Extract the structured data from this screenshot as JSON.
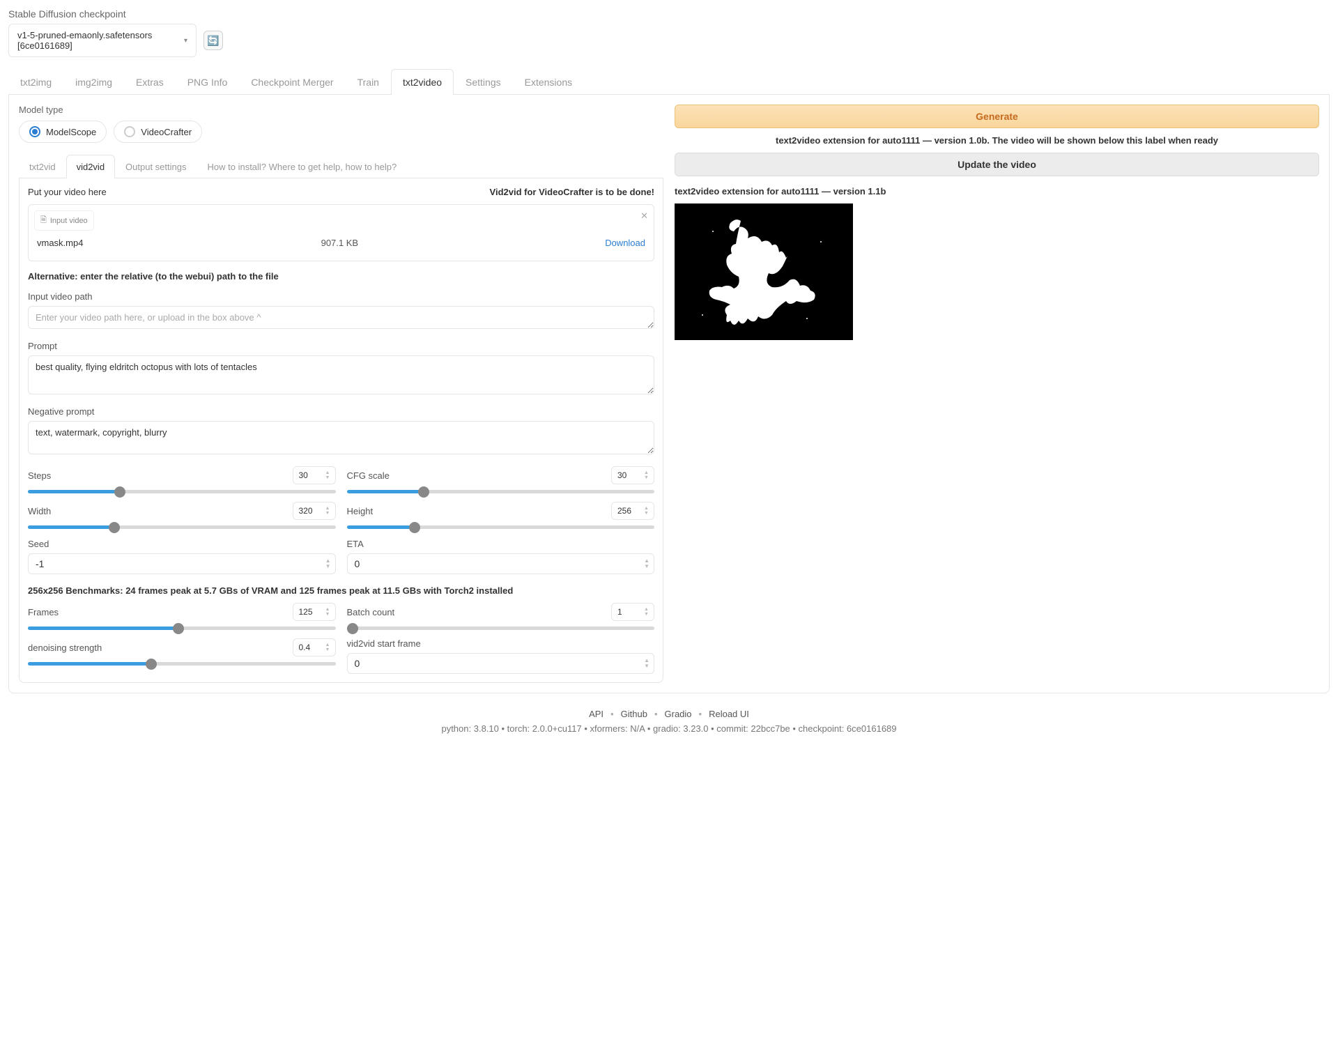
{
  "checkpoint": {
    "label": "Stable Diffusion checkpoint",
    "value": "v1-5-pruned-emaonly.safetensors [6ce0161689]"
  },
  "main_tabs": [
    "txt2img",
    "img2img",
    "Extras",
    "PNG Info",
    "Checkpoint Merger",
    "Train",
    "txt2video",
    "Settings",
    "Extensions"
  ],
  "main_tab_active": "txt2video",
  "model_type": {
    "label": "Model type",
    "options": [
      "ModelScope",
      "VideoCrafter"
    ],
    "selected": "ModelScope"
  },
  "sub_tabs": [
    "txt2vid",
    "vid2vid",
    "Output settings",
    "How to install? Where to get help, how to help?"
  ],
  "sub_tab_active": "vid2vid",
  "upload": {
    "prompt": "Put your video here",
    "note": "Vid2vid for VideoCrafter is to be done!",
    "badge": "Input video",
    "filename": "vmask.mp4",
    "size": "907.1 KB",
    "download": "Download"
  },
  "alt_note": "Alternative: enter the relative (to the webui) path to the file",
  "video_path": {
    "label": "Input video path",
    "placeholder": "Enter your video path here, or upload in the box above ^",
    "value": ""
  },
  "prompt": {
    "label": "Prompt",
    "value": "best quality, flying eldritch octopus with lots of tentacles"
  },
  "neg_prompt": {
    "label": "Negative prompt",
    "value": "text, watermark, copyright, blurry"
  },
  "sliders": {
    "steps": {
      "label": "Steps",
      "value": 30,
      "pct": 30
    },
    "cfg": {
      "label": "CFG scale",
      "value": 30,
      "pct": 25
    },
    "width": {
      "label": "Width",
      "value": 320,
      "pct": 28
    },
    "height": {
      "label": "Height",
      "value": 256,
      "pct": 22
    },
    "frames": {
      "label": "Frames",
      "value": 125,
      "pct": 49
    },
    "batch": {
      "label": "Batch count",
      "value": 1,
      "pct": 2
    },
    "denoise": {
      "label": "denoising strength",
      "value": 0.4,
      "pct": 40
    }
  },
  "seed": {
    "label": "Seed",
    "value": "-1"
  },
  "eta": {
    "label": "ETA",
    "value": "0"
  },
  "start_frame": {
    "label": "vid2vid start frame",
    "value": "0"
  },
  "bench_note": "256x256 Benchmarks: 24 frames peak at 5.7 GBs of VRAM and 125 frames peak at 11.5 GBs with Torch2 installed",
  "right": {
    "generate": "Generate",
    "info": "text2video extension for auto1111 — version 1.0b. The video will be shown below this label when ready",
    "update": "Update the video",
    "version": "text2video extension for auto1111 — version 1.1b"
  },
  "footer": {
    "links": [
      "API",
      "Github",
      "Gradio",
      "Reload UI"
    ],
    "meta": "python: 3.8.10  •  torch: 2.0.0+cu117  •  xformers: N/A  •  gradio: 3.23.0  •  commit: 22bcc7be  •  checkpoint: 6ce0161689"
  }
}
